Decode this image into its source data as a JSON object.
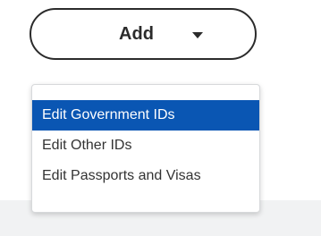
{
  "add_button": {
    "label": "Add",
    "icon": "caret-down-icon"
  },
  "dropdown": {
    "items": [
      {
        "label": "Edit Government IDs",
        "selected": true
      },
      {
        "label": "Edit Other IDs",
        "selected": false
      },
      {
        "label": "Edit Passports and Visas",
        "selected": false
      }
    ]
  },
  "colors": {
    "selected_background": "#0a56b3",
    "selected_text": "#ffffff",
    "text": "#333333",
    "button_border": "#2b2b2b",
    "page_background_strip": "#f1f2f3"
  }
}
